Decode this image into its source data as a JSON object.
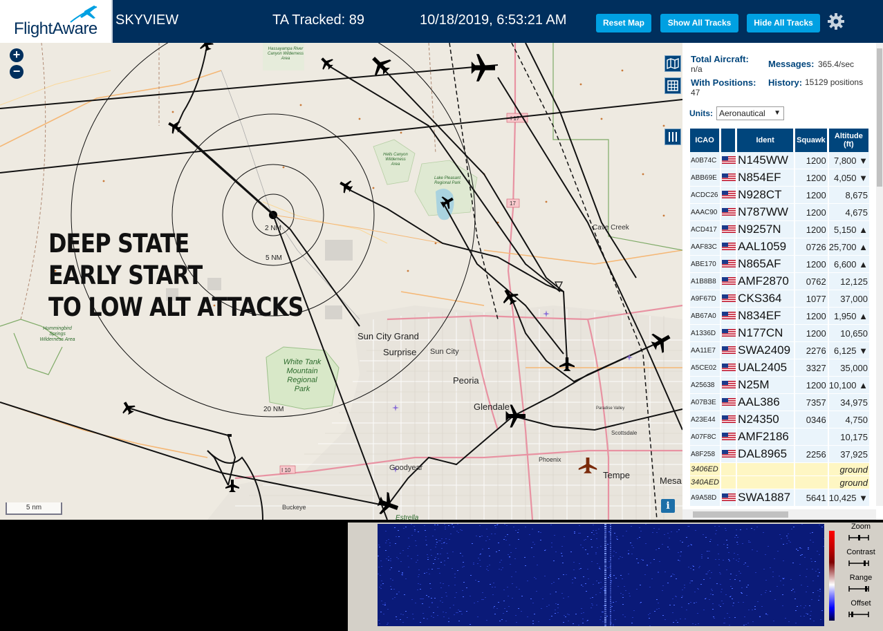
{
  "header": {
    "logo_text": "FlightAware",
    "site_name": "SKYVIEW",
    "tracked": "TA Tracked: 89",
    "datetime": "10/18/2019, 6:53:21 AM",
    "buttons": {
      "reset": "Reset Map",
      "show": "Show All Tracks",
      "hide": "Hide All Tracks"
    },
    "colors": {
      "bar": "#002f5d",
      "button": "#00a0e2"
    }
  },
  "map": {
    "overlay_text": [
      "DEEP STATE",
      "EARLY START",
      "TO LOW ALT ATTACKS"
    ],
    "ring_labels": [
      "2 NM",
      "5 NM",
      "20 NM"
    ],
    "scale_label": "5 nm",
    "zoom_in": "+",
    "zoom_out": "−",
    "info": "i",
    "place_labels": {
      "sun_city_grand": "Sun City Grand",
      "surprise": "Surprise",
      "sun_city": "Sun City",
      "peoria": "Peoria",
      "glendale": "Glendale",
      "phoenix": "Phoenix",
      "tempe": "Tempe",
      "mesa": "Mesa",
      "goodyear": "Goodyear",
      "buckeye": "Buckeye",
      "scottsdale": "Scottsdale",
      "cave_creek": "Cave Creek",
      "estrella": "Estrella",
      "white_tank": "White Tank Mountain Regional Park",
      "hummingbird": "Hummingbird Springs Wilderness Area",
      "hassayampa": "Hassayampa River Canyon Wilderness Area",
      "hells_canyon": "Hells Canyon Wilderness Area",
      "lake_pleasant": "Lake Pleasant Regional Park",
      "paradise_valley": "Paradise Valley",
      "i17": "I 17",
      "i10": "I 10"
    }
  },
  "panel": {
    "total_label": "Total Aircraft:",
    "total_value": "n/a",
    "messages_label": "Messages:",
    "messages_value": "365.4/sec",
    "with_pos_label": "With Positions:",
    "with_pos_value": "47",
    "history_label": "History:",
    "history_value": "15129 positions",
    "units_label": "Units:",
    "units_value": "Aeronautical",
    "columns": [
      "ICAO",
      "",
      "Ident",
      "Squawk",
      "Altitude (ft)"
    ],
    "rows": [
      {
        "icao": "A0B74C",
        "ident": "N145WW",
        "squawk": "1200",
        "alt": "7,800 ▼",
        "ground": false
      },
      {
        "icao": "ABB69E",
        "ident": "N854EF",
        "squawk": "1200",
        "alt": "4,050 ▼",
        "ground": false
      },
      {
        "icao": "ACDC26",
        "ident": "N928CT",
        "squawk": "1200",
        "alt": "8,675",
        "ground": false
      },
      {
        "icao": "AAAC90",
        "ident": "N787WW",
        "squawk": "1200",
        "alt": "4,675",
        "ground": false
      },
      {
        "icao": "ACD417",
        "ident": "N9257N",
        "squawk": "1200",
        "alt": "5,150 ▲",
        "ground": false
      },
      {
        "icao": "AAF83C",
        "ident": "AAL1059",
        "squawk": "0726",
        "alt": "25,700 ▲",
        "ground": false
      },
      {
        "icao": "ABE170",
        "ident": "N865AF",
        "squawk": "1200",
        "alt": "6,600 ▲",
        "ground": false
      },
      {
        "icao": "A1B8B8",
        "ident": "AMF2870",
        "squawk": "0762",
        "alt": "12,125",
        "ground": false
      },
      {
        "icao": "A9F67D",
        "ident": "CKS364",
        "squawk": "1077",
        "alt": "37,000",
        "ground": false
      },
      {
        "icao": "AB67A0",
        "ident": "N834EF",
        "squawk": "1200",
        "alt": "1,950 ▲",
        "ground": false
      },
      {
        "icao": "A1336D",
        "ident": "N177CN",
        "squawk": "1200",
        "alt": "10,650",
        "ground": false
      },
      {
        "icao": "AA11E7",
        "ident": "SWA2409",
        "squawk": "2276",
        "alt": "6,125 ▼",
        "ground": false
      },
      {
        "icao": "A5CE02",
        "ident": "UAL2405",
        "squawk": "3327",
        "alt": "35,000",
        "ground": false
      },
      {
        "icao": "A25638",
        "ident": "N25M",
        "squawk": "1200",
        "alt": "10,100 ▲",
        "ground": false
      },
      {
        "icao": "A07B3E",
        "ident": "AAL386",
        "squawk": "7357",
        "alt": "34,975",
        "ground": false
      },
      {
        "icao": "A23E44",
        "ident": "N24350",
        "squawk": "0346",
        "alt": "4,750",
        "ground": false
      },
      {
        "icao": "A07F8C",
        "ident": "AMF2186",
        "squawk": "",
        "alt": "10,175",
        "ground": false
      },
      {
        "icao": "A8F258",
        "ident": "DAL8965",
        "squawk": "2256",
        "alt": "37,925",
        "ground": false
      },
      {
        "icao": "3406ED",
        "ident": "",
        "squawk": "",
        "alt": "ground",
        "ground": true
      },
      {
        "icao": "340AED",
        "ident": "",
        "squawk": "",
        "alt": "ground",
        "ground": true
      },
      {
        "icao": "A9A58D",
        "ident": "SWA1887",
        "squawk": "5641",
        "alt": "10,425 ▼",
        "ground": false
      }
    ]
  },
  "waterfall": {
    "labels": [
      "Zoom",
      "Contrast",
      "Range",
      "Offset"
    ]
  }
}
